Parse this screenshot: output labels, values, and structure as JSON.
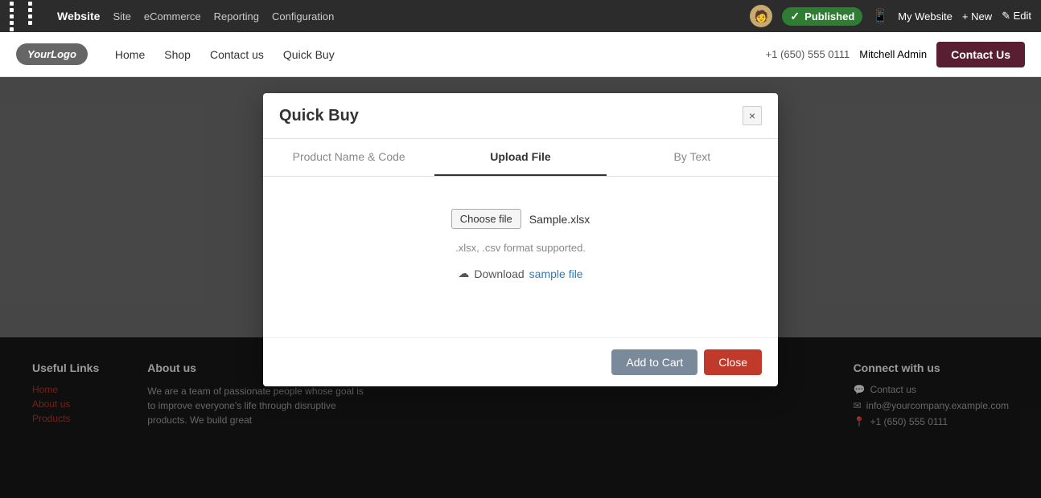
{
  "adminBar": {
    "siteName": "Website",
    "navItems": [
      "Site",
      "eCommerce",
      "Reporting",
      "Configuration"
    ],
    "published": "Published",
    "myWebsite": "My Website",
    "new": "+ New",
    "edit": "✎ Edit"
  },
  "websiteNav": {
    "logo": "YourLogo",
    "links": [
      "Home",
      "Shop",
      "Contact us",
      "Quick Buy"
    ],
    "phone": "+1 (650) 555 0111",
    "adminName": "Mitchell Admin",
    "contactUs": "Contact Us"
  },
  "modal": {
    "title": "Quick Buy",
    "close": "×",
    "tabs": [
      {
        "label": "Product Name & Code",
        "active": false
      },
      {
        "label": "Upload File",
        "active": true
      },
      {
        "label": "By Text",
        "active": false
      }
    ],
    "chooseFile": "Choose file",
    "fileName": "Sample.xlsx",
    "formatHint": ".xlsx, .csv format supported.",
    "downloadLabel": "Download",
    "downloadLink": "sample file",
    "addToCart": "Add to Cart",
    "closeBtn": "Close"
  },
  "footer": {
    "usefulLinks": {
      "title": "Useful Links",
      "links": [
        "Home",
        "About us",
        "Products"
      ]
    },
    "aboutUs": {
      "title": "About us",
      "text": "We are a team of passionate people whose goal is to improve everyone's life through disruptive products. We build great"
    },
    "connectWithUs": {
      "title": "Connect with us",
      "items": [
        {
          "icon": "💬",
          "text": "Contact us"
        },
        {
          "icon": "✉",
          "text": "info@yourcompany.example.com"
        },
        {
          "icon": "📍",
          "text": "+1 (650) 555 0111"
        }
      ]
    }
  }
}
